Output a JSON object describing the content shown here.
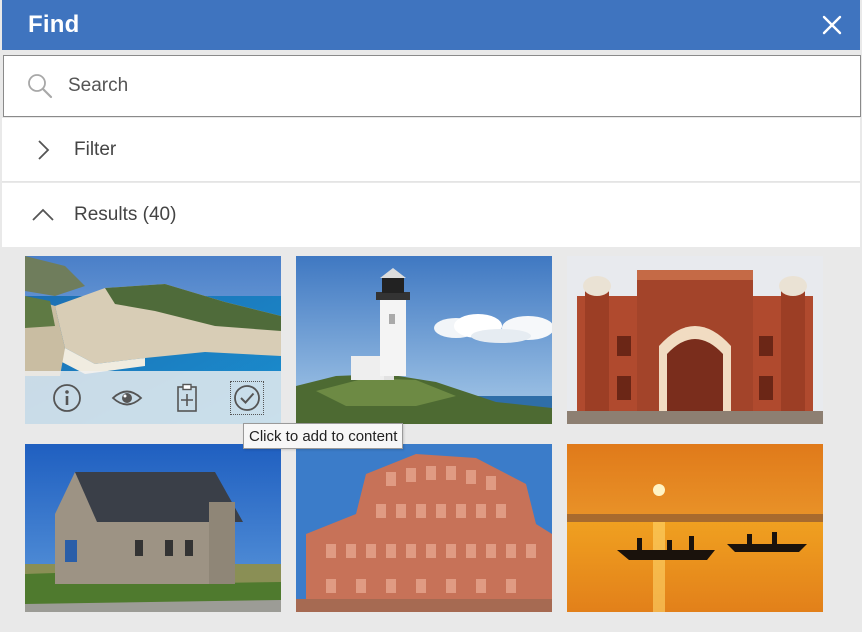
{
  "header": {
    "title": "Find",
    "close_icon": "close-icon"
  },
  "search": {
    "placeholder": "Search",
    "value": "",
    "icon": "search-icon"
  },
  "sections": {
    "filter": {
      "label": "Filter",
      "state": "collapsed",
      "icon": "chevron-right-icon"
    },
    "results": {
      "label": "Results (40)",
      "state": "expanded",
      "icon": "chevron-up-icon"
    }
  },
  "results": {
    "items": [
      {
        "subject": "coastal cliff bay with white beach",
        "hovered": true
      },
      {
        "subject": "white lighthouse on rocky headland",
        "hovered": false
      },
      {
        "subject": "red sandstone mosque gateway",
        "hovered": false
      },
      {
        "subject": "stone chapel under blue sky",
        "hovered": false
      },
      {
        "subject": "pink honeycomb palace facade",
        "hovered": false
      },
      {
        "subject": "boats on river at sunset",
        "hovered": false
      }
    ],
    "hover_actions": [
      "info-icon",
      "preview-eye-icon",
      "add-clipboard-icon",
      "select-check-icon"
    ],
    "tooltip": "Click to add to content"
  },
  "colors": {
    "header_bg": "#3f74bf",
    "panel_bg": "#e9e9e9"
  }
}
